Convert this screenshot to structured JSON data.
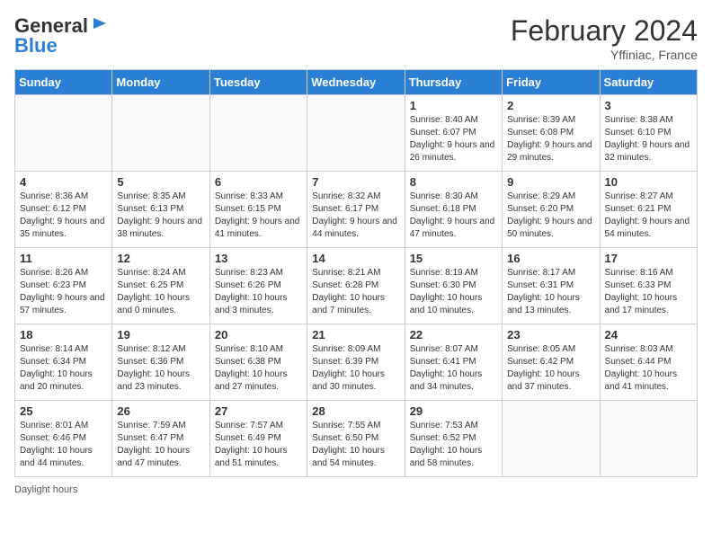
{
  "header": {
    "logo_line1": "General",
    "logo_line2": "Blue",
    "month_title": "February 2024",
    "location": "Yffiniac, France"
  },
  "days_of_week": [
    "Sunday",
    "Monday",
    "Tuesday",
    "Wednesday",
    "Thursday",
    "Friday",
    "Saturday"
  ],
  "weeks": [
    [
      {
        "day": "",
        "info": ""
      },
      {
        "day": "",
        "info": ""
      },
      {
        "day": "",
        "info": ""
      },
      {
        "day": "",
        "info": ""
      },
      {
        "day": "1",
        "info": "Sunrise: 8:40 AM\nSunset: 6:07 PM\nDaylight: 9 hours and 26 minutes."
      },
      {
        "day": "2",
        "info": "Sunrise: 8:39 AM\nSunset: 6:08 PM\nDaylight: 9 hours and 29 minutes."
      },
      {
        "day": "3",
        "info": "Sunrise: 8:38 AM\nSunset: 6:10 PM\nDaylight: 9 hours and 32 minutes."
      }
    ],
    [
      {
        "day": "4",
        "info": "Sunrise: 8:36 AM\nSunset: 6:12 PM\nDaylight: 9 hours and 35 minutes."
      },
      {
        "day": "5",
        "info": "Sunrise: 8:35 AM\nSunset: 6:13 PM\nDaylight: 9 hours and 38 minutes."
      },
      {
        "day": "6",
        "info": "Sunrise: 8:33 AM\nSunset: 6:15 PM\nDaylight: 9 hours and 41 minutes."
      },
      {
        "day": "7",
        "info": "Sunrise: 8:32 AM\nSunset: 6:17 PM\nDaylight: 9 hours and 44 minutes."
      },
      {
        "day": "8",
        "info": "Sunrise: 8:30 AM\nSunset: 6:18 PM\nDaylight: 9 hours and 47 minutes."
      },
      {
        "day": "9",
        "info": "Sunrise: 8:29 AM\nSunset: 6:20 PM\nDaylight: 9 hours and 50 minutes."
      },
      {
        "day": "10",
        "info": "Sunrise: 8:27 AM\nSunset: 6:21 PM\nDaylight: 9 hours and 54 minutes."
      }
    ],
    [
      {
        "day": "11",
        "info": "Sunrise: 8:26 AM\nSunset: 6:23 PM\nDaylight: 9 hours and 57 minutes."
      },
      {
        "day": "12",
        "info": "Sunrise: 8:24 AM\nSunset: 6:25 PM\nDaylight: 10 hours and 0 minutes."
      },
      {
        "day": "13",
        "info": "Sunrise: 8:23 AM\nSunset: 6:26 PM\nDaylight: 10 hours and 3 minutes."
      },
      {
        "day": "14",
        "info": "Sunrise: 8:21 AM\nSunset: 6:28 PM\nDaylight: 10 hours and 7 minutes."
      },
      {
        "day": "15",
        "info": "Sunrise: 8:19 AM\nSunset: 6:30 PM\nDaylight: 10 hours and 10 minutes."
      },
      {
        "day": "16",
        "info": "Sunrise: 8:17 AM\nSunset: 6:31 PM\nDaylight: 10 hours and 13 minutes."
      },
      {
        "day": "17",
        "info": "Sunrise: 8:16 AM\nSunset: 6:33 PM\nDaylight: 10 hours and 17 minutes."
      }
    ],
    [
      {
        "day": "18",
        "info": "Sunrise: 8:14 AM\nSunset: 6:34 PM\nDaylight: 10 hours and 20 minutes."
      },
      {
        "day": "19",
        "info": "Sunrise: 8:12 AM\nSunset: 6:36 PM\nDaylight: 10 hours and 23 minutes."
      },
      {
        "day": "20",
        "info": "Sunrise: 8:10 AM\nSunset: 6:38 PM\nDaylight: 10 hours and 27 minutes."
      },
      {
        "day": "21",
        "info": "Sunrise: 8:09 AM\nSunset: 6:39 PM\nDaylight: 10 hours and 30 minutes."
      },
      {
        "day": "22",
        "info": "Sunrise: 8:07 AM\nSunset: 6:41 PM\nDaylight: 10 hours and 34 minutes."
      },
      {
        "day": "23",
        "info": "Sunrise: 8:05 AM\nSunset: 6:42 PM\nDaylight: 10 hours and 37 minutes."
      },
      {
        "day": "24",
        "info": "Sunrise: 8:03 AM\nSunset: 6:44 PM\nDaylight: 10 hours and 41 minutes."
      }
    ],
    [
      {
        "day": "25",
        "info": "Sunrise: 8:01 AM\nSunset: 6:46 PM\nDaylight: 10 hours and 44 minutes."
      },
      {
        "day": "26",
        "info": "Sunrise: 7:59 AM\nSunset: 6:47 PM\nDaylight: 10 hours and 47 minutes."
      },
      {
        "day": "27",
        "info": "Sunrise: 7:57 AM\nSunset: 6:49 PM\nDaylight: 10 hours and 51 minutes."
      },
      {
        "day": "28",
        "info": "Sunrise: 7:55 AM\nSunset: 6:50 PM\nDaylight: 10 hours and 54 minutes."
      },
      {
        "day": "29",
        "info": "Sunrise: 7:53 AM\nSunset: 6:52 PM\nDaylight: 10 hours and 58 minutes."
      },
      {
        "day": "",
        "info": ""
      },
      {
        "day": "",
        "info": ""
      }
    ]
  ],
  "footer": {
    "label": "Daylight hours"
  }
}
